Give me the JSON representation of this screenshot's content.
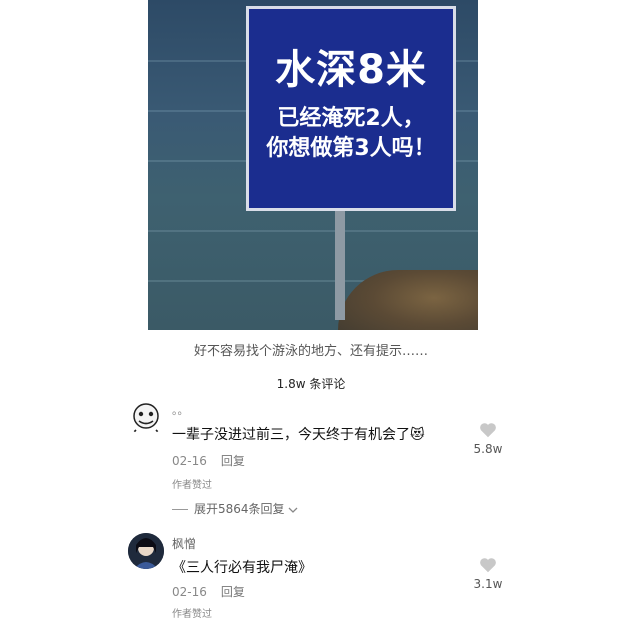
{
  "photo": {
    "sign_title": "水深8米",
    "sign_line1": "已经淹死2人，",
    "sign_line2": "你想做第3人吗！"
  },
  "post": {
    "caption": "好不容易找个游泳的地方、还有提示……",
    "comments_count": "1.8w 条评论"
  },
  "comments": [
    {
      "username": "。。",
      "text": "一辈子没进过前三，今天终于有机会了",
      "emoji": "😻",
      "date": "02-16",
      "reply_label": "回复",
      "author_liked": "作者赞过",
      "expand": "展开5864条回复",
      "likes": "5.8w"
    },
    {
      "username": "枫憎",
      "text": "《三人行必有我尸淹》",
      "date": "02-16",
      "reply_label": "回复",
      "author_liked": "作者赞过",
      "likes": "3.1w"
    }
  ],
  "colors": {
    "sign_blue": "#1b2d8f",
    "like_heart": "#c8c8c8"
  }
}
